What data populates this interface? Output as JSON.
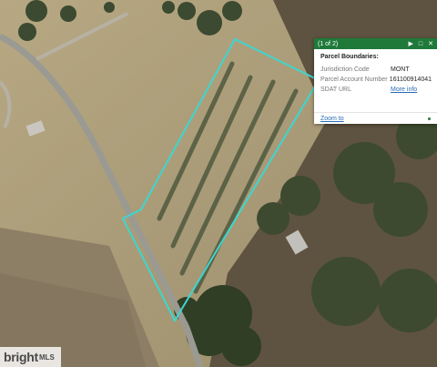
{
  "map": {
    "parcel_outline_color": "#3dd6d0",
    "popup": {
      "counter": "(1 of 2)",
      "next_icon": "play-icon",
      "maximize_icon": "maximize-icon",
      "close_icon": "close-icon",
      "title": "Parcel Boundaries:",
      "rows": [
        {
          "label": "Jurisdiction Code",
          "value": "MONT"
        },
        {
          "label": "Parcel Account Number",
          "value": "161100914041"
        },
        {
          "label": "SDAT URL",
          "value": "More info"
        }
      ],
      "zoom_link": "Zoom to",
      "header_color": "#1f7a3a"
    },
    "watermark": {
      "brand": "bright",
      "suffix": "MLS"
    }
  }
}
